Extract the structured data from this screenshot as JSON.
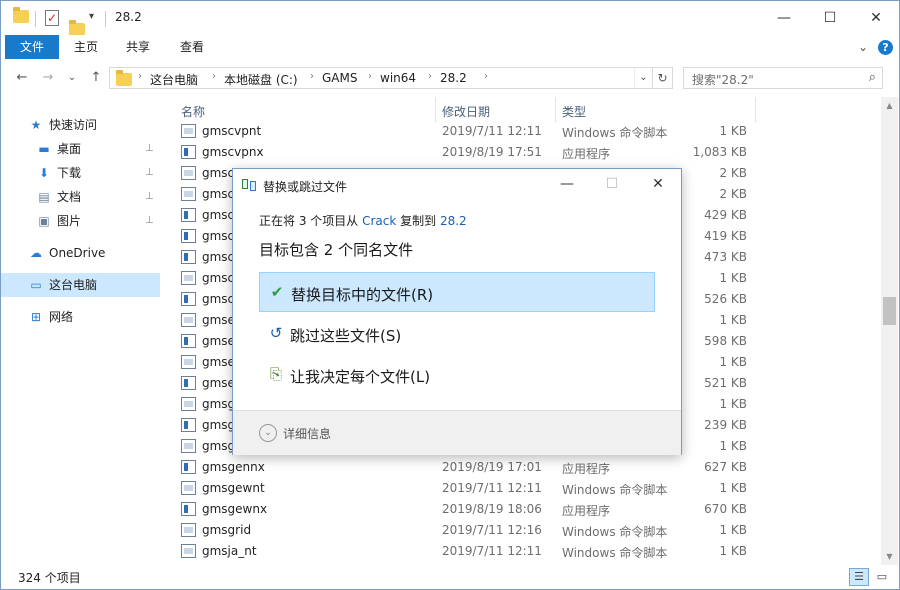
{
  "window": {
    "title": "28.2",
    "controls": {
      "minimize": "—",
      "maximize": "☐",
      "close": "✕"
    }
  },
  "ribbon": {
    "tabs": [
      "文件",
      "主页",
      "共享",
      "查看"
    ],
    "expand": "⌄",
    "help": "?"
  },
  "address": {
    "back": "←",
    "forward": "→",
    "recent": "⌄",
    "up": "↑",
    "crumbs": [
      "这台电脑",
      "本地磁盘 (C:)",
      "GAMS",
      "win64",
      "28.2"
    ],
    "crumb_separator": "›",
    "dropdown": "⌄",
    "refresh": "↻",
    "search_placeholder": "搜索\"28.2\"",
    "search_icon": "⌕"
  },
  "sidebar": {
    "items": [
      {
        "label": "快速访问",
        "icon": "star-icon",
        "glyph": "★",
        "color": "#2b7bd6"
      },
      {
        "label": "桌面",
        "icon": "desktop-icon",
        "glyph": "▬",
        "color": "#2b7bd6",
        "pinned": true
      },
      {
        "label": "下载",
        "icon": "download-icon",
        "glyph": "⬇",
        "color": "#2b7bd6",
        "pinned": true
      },
      {
        "label": "文档",
        "icon": "document-icon",
        "glyph": "▤",
        "color": "#6a7f99",
        "pinned": true
      },
      {
        "label": "图片",
        "icon": "picture-icon",
        "glyph": "▣",
        "color": "#6a7f99",
        "pinned": true
      },
      {
        "label": "OneDrive",
        "icon": "cloud-icon",
        "glyph": "☁",
        "color": "#2b7bd6"
      },
      {
        "label": "这台电脑",
        "icon": "computer-icon",
        "glyph": "▭",
        "color": "#2b7bd6",
        "selected": true
      },
      {
        "label": "网络",
        "icon": "network-icon",
        "glyph": "⊞",
        "color": "#2b7bd6"
      }
    ],
    "pin_glyph": "📌"
  },
  "list": {
    "sort_caret": "^",
    "columns": {
      "name": "名称",
      "date": "修改日期",
      "type": "类型"
    },
    "rows": [
      {
        "name": "gmscvpnt",
        "date": "2019/7/11 12:11",
        "type": "Windows 命令脚本",
        "size": "1 KB",
        "kind": "cmd"
      },
      {
        "name": "gmscvpnx",
        "date": "2019/8/19 17:51",
        "type": "应用程序",
        "size": "1,083 KB",
        "kind": "exe"
      },
      {
        "name": "gmsc",
        "date": "",
        "type": "",
        "size": "2 KB",
        "kind": "cmd"
      },
      {
        "name": "gmsc",
        "date": "",
        "type": "",
        "size": "2 KB",
        "kind": "cmd"
      },
      {
        "name": "gmsc",
        "date": "",
        "type": "",
        "size": "429 KB",
        "kind": "exe"
      },
      {
        "name": "gmsc",
        "date": "",
        "type": "",
        "size": "419 KB",
        "kind": "exe"
      },
      {
        "name": "gmsc",
        "date": "",
        "type": "",
        "size": "473 KB",
        "kind": "exe"
      },
      {
        "name": "gmsc",
        "date": "",
        "type": "",
        "size": "1 KB",
        "kind": "cmd"
      },
      {
        "name": "gmsc",
        "date": "",
        "type": "",
        "size": "526 KB",
        "kind": "exe"
      },
      {
        "name": "gmse",
        "date": "",
        "type": "",
        "size": "1 KB",
        "kind": "cmd"
      },
      {
        "name": "gmse",
        "date": "",
        "type": "",
        "size": "598 KB",
        "kind": "exe"
      },
      {
        "name": "gmse",
        "date": "",
        "type": "",
        "size": "1 KB",
        "kind": "cmd"
      },
      {
        "name": "gmse",
        "date": "",
        "type": "",
        "size": "521 KB",
        "kind": "exe"
      },
      {
        "name": "gmsg",
        "date": "",
        "type": "",
        "size": "1 KB",
        "kind": "cmd"
      },
      {
        "name": "gmsg",
        "date": "",
        "type": "",
        "size": "239 KB",
        "kind": "exe"
      },
      {
        "name": "gmsg",
        "date": "",
        "type": "",
        "size": "1 KB",
        "kind": "cmd"
      },
      {
        "name": "gmsgennx",
        "date": "2019/8/19 17:01",
        "type": "应用程序",
        "size": "627 KB",
        "kind": "exe"
      },
      {
        "name": "gmsgewnt",
        "date": "2019/7/11 12:11",
        "type": "Windows 命令脚本",
        "size": "1 KB",
        "kind": "cmd"
      },
      {
        "name": "gmsgewnx",
        "date": "2019/8/19 18:06",
        "type": "应用程序",
        "size": "670 KB",
        "kind": "exe"
      },
      {
        "name": "gmsgrid",
        "date": "2019/7/11 12:16",
        "type": "Windows 命令脚本",
        "size": "1 KB",
        "kind": "cmd"
      },
      {
        "name": "gmsja_nt",
        "date": "2019/7/11 12:11",
        "type": "Windows 命令脚本",
        "size": "1 KB",
        "kind": "cmd"
      }
    ]
  },
  "scrollbar": {
    "up": "▲",
    "down": "▼",
    "position": 0.45
  },
  "status": {
    "count": "324 个项目",
    "details_view": "☰",
    "icons_view": "▭"
  },
  "dialog": {
    "title": "替换或跳过文件",
    "controls": {
      "minimize": "—",
      "maximize": "☐",
      "close": "✕"
    },
    "line_prefix": "正在将 3 个项目从 ",
    "source": "Crack",
    "line_middle": " 复制到 ",
    "destination": "28.2",
    "heading": "目标包含 2 个同名文件",
    "options": [
      {
        "label": "替换目标中的文件(R)",
        "icon": "checkmark-icon",
        "glyph": "✔",
        "color": "#2e9b3c",
        "highlighted": true
      },
      {
        "label": "跳过这些文件(S)",
        "icon": "skip-icon",
        "glyph": "↺",
        "color": "#1a5fb4",
        "highlighted": false
      },
      {
        "label": "让我决定每个文件(L)",
        "icon": "decide-icon",
        "glyph": "⎘",
        "color": "#5a8a3a",
        "highlighted": false
      }
    ],
    "more_glyph": "⌄",
    "more_label": "详细信息"
  }
}
